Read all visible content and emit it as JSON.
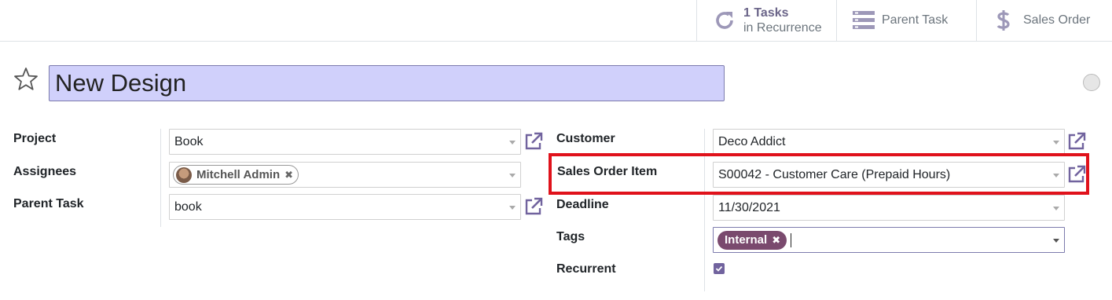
{
  "smart_buttons": {
    "recurrence": {
      "count_label": "1 Tasks",
      "sub_label": "in Recurrence",
      "icon": "refresh-icon"
    },
    "parent_task": {
      "label": "Parent Task",
      "icon": "tasks-list-icon"
    },
    "sales_order": {
      "label": "Sales Order",
      "icon": "dollar-icon"
    }
  },
  "title": {
    "value": "New Design",
    "star_icon": "star-outline-icon"
  },
  "left_fields": {
    "project": {
      "label": "Project",
      "value": "Book"
    },
    "assignees": {
      "label": "Assignees",
      "chips": [
        {
          "name": "Mitchell Admin"
        }
      ]
    },
    "parent_task": {
      "label": "Parent Task",
      "value": "book"
    }
  },
  "right_fields": {
    "customer": {
      "label": "Customer",
      "value": "Deco Addict"
    },
    "sales_order_item": {
      "label": "Sales Order Item",
      "value": "S00042 - Customer Care (Prepaid Hours)"
    },
    "deadline": {
      "label": "Deadline",
      "value": "11/30/2021"
    },
    "tags": {
      "label": "Tags",
      "chips": [
        {
          "name": "Internal"
        }
      ]
    },
    "recurrent": {
      "label": "Recurrent",
      "checked": true
    }
  },
  "colors": {
    "accent": "#71639e",
    "title_background": "#d0d0fb",
    "tag_internal": "#7a4a6e",
    "highlight_border": "#e0121b"
  }
}
